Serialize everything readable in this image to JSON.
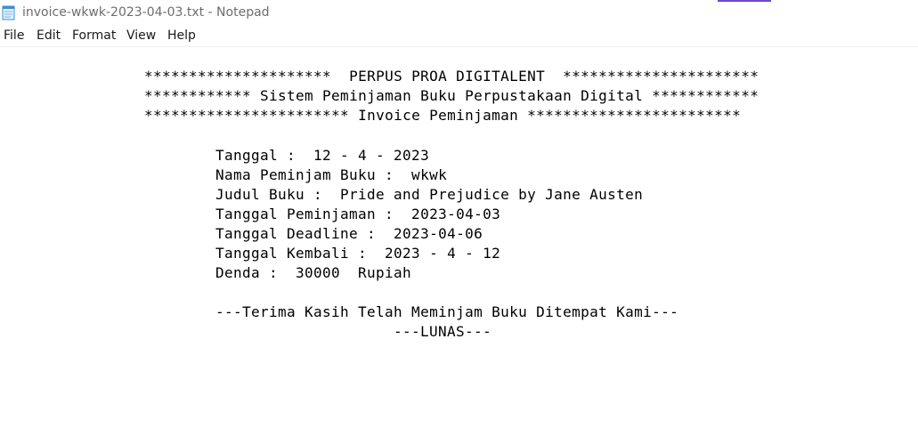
{
  "window": {
    "title": "invoice-wkwk-2023-04-03.txt - Notepad",
    "accent_color": "#6b47c8"
  },
  "menu": {
    "file": "File",
    "edit": "Edit",
    "format": "Format",
    "view": "View",
    "help": "Help"
  },
  "document": {
    "header_line_1": "*********************  PERPUS PROA DIGITALENT  **********************",
    "header_line_2": "************ Sistem Peminjaman Buku Perpustakaan Digital ************",
    "header_line_3": "*********************** Invoice Peminjaman ************************",
    "tanggal": "Tanggal :  12 - 4 - 2023",
    "nama_peminjam": "Nama Peminjam Buku :  wkwk",
    "judul_buku": "Judul Buku :  Pride and Prejudice by Jane Austen",
    "tanggal_peminjaman": "Tanggal Peminjaman :  2023-04-03",
    "tanggal_deadline": "Tanggal Deadline :  2023-04-06",
    "tanggal_kembali": "Tanggal Kembali :  2023 - 4 - 12",
    "denda": "Denda :  30000  Rupiah",
    "terima_kasih": "---Terima Kasih Telah Meminjam Buku Ditempat Kami---",
    "lunas": "---LUNAS---"
  }
}
